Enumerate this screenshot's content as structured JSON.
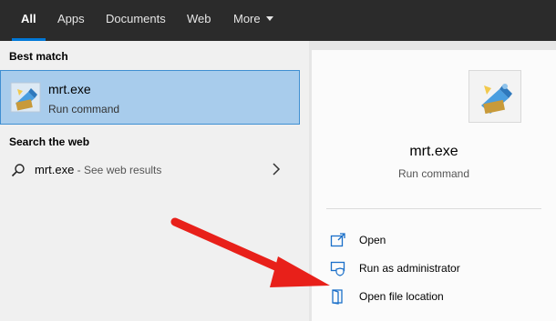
{
  "tabs": [
    {
      "label": "All"
    },
    {
      "label": "Apps"
    },
    {
      "label": "Documents"
    },
    {
      "label": "Web"
    },
    {
      "label": "More"
    }
  ],
  "best_match": {
    "section_title": "Best match",
    "name": "mrt.exe",
    "subtitle": "Run command",
    "icon": "mrt-app-icon"
  },
  "search_web": {
    "section_title": "Search the web",
    "query": "mrt.exe",
    "suffix": " - See web results",
    "icon": "search-icon"
  },
  "details": {
    "name": "mrt.exe",
    "subtitle": "Run command",
    "actions": [
      {
        "label": "Open",
        "icon": "open-icon"
      },
      {
        "label": "Run as administrator",
        "icon": "shield-icon"
      },
      {
        "label": "Open file location",
        "icon": "folder-icon"
      }
    ]
  },
  "colors": {
    "accent": "#0078d7",
    "selection": "#a8ccec",
    "annotation_arrow": "#e8201a"
  }
}
